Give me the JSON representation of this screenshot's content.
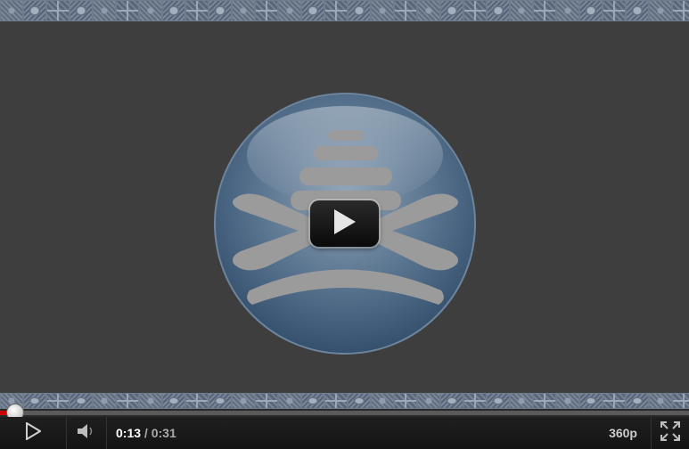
{
  "player": {
    "current_time": "0:13",
    "time_separator": " / ",
    "duration": "0:31",
    "quality": "360p",
    "progress_fraction": 0.021,
    "accent_color": "#cc0000",
    "icons": {
      "big_play": "play-icon",
      "play": "play-icon",
      "volume": "speaker-icon",
      "fullscreen": "fullscreen-icon",
      "logo": "xcp-logo"
    }
  }
}
